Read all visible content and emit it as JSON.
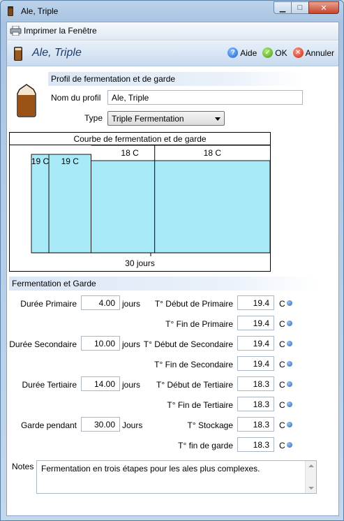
{
  "window": {
    "title": "Ale, Triple",
    "minimize": "▁",
    "maximize": "□",
    "close": "✕"
  },
  "toolbar": {
    "print_label": "Imprimer la Fenêtre"
  },
  "header": {
    "title": "Ale, Triple",
    "help_label": "Aide",
    "ok_label": "OK",
    "cancel_label": "Annuler"
  },
  "profile": {
    "section_title": "Profil de fermentation et de garde",
    "name_label": "Nom du profil",
    "name_value": "Ale, Triple",
    "type_label": "Type",
    "type_value": "Triple Fermentation"
  },
  "chart_data": {
    "type": "area",
    "title": "Courbe de fermentation et de garde",
    "xlabel": "30 jours",
    "total_days": 30,
    "fill_color": "#a9eaf8",
    "segments": [
      {
        "label": "19 C",
        "days": 4.0,
        "temp": 19.4
      },
      {
        "label": "19 C",
        "days": 10.0,
        "temp": 19.4
      },
      {
        "label": "18 C",
        "days": 14.0,
        "temp": 18.3
      },
      {
        "label": "18 C",
        "days": 30.0,
        "temp": 18.3
      }
    ]
  },
  "fermentation": {
    "section_title": "Fermentation et Garde",
    "unit": "C",
    "rows": [
      {
        "dur_label": "Durée Primaire",
        "dur_value": "4.00",
        "dur_unit": "jours",
        "temp_label": "T° Début de Primaire",
        "temp_value": "19.4"
      },
      {
        "dur_label": "",
        "dur_value": "",
        "dur_unit": "",
        "temp_label": "T° Fin de Primaire",
        "temp_value": "19.4"
      },
      {
        "dur_label": "Durée Secondaire",
        "dur_value": "10.00",
        "dur_unit": "jours",
        "temp_label": "T° Début de Secondaire",
        "temp_value": "19.4"
      },
      {
        "dur_label": "",
        "dur_value": "",
        "dur_unit": "",
        "temp_label": "T° Fin de Secondaire",
        "temp_value": "19.4"
      },
      {
        "dur_label": "Durée Tertiaire",
        "dur_value": "14.00",
        "dur_unit": "jours",
        "temp_label": "T° Début de Tertiaire",
        "temp_value": "18.3"
      },
      {
        "dur_label": "",
        "dur_value": "",
        "dur_unit": "",
        "temp_label": "T° Fin de Tertiaire",
        "temp_value": "18.3"
      },
      {
        "dur_label": "Garde pendant",
        "dur_value": "30.00",
        "dur_unit": "Jours",
        "temp_label": "T° Stockage",
        "temp_value": "18.3"
      },
      {
        "dur_label": "",
        "dur_value": "",
        "dur_unit": "",
        "temp_label": "T° fin de garde",
        "temp_value": "18.3"
      }
    ]
  },
  "notes": {
    "label": "Notes",
    "value": "Fermentation en trois étapes pour les ales plus complexes."
  }
}
